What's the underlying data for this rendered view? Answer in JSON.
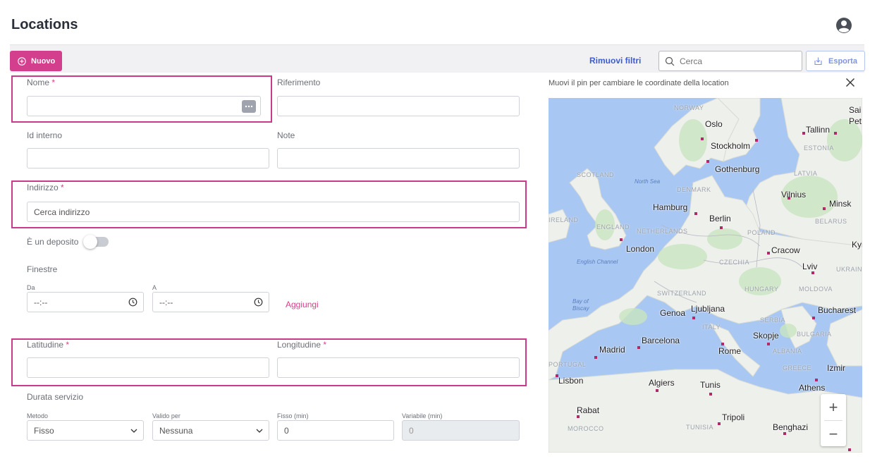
{
  "header": {
    "title": "Locations"
  },
  "toolbar": {
    "new_label": "Nuovo",
    "remove_filters_label": "Rimuovi filtri",
    "search_placeholder": "Cerca",
    "export_label": "Esporta"
  },
  "form": {
    "name_label": "Nome",
    "reference_label": "Riferimento",
    "internal_id_label": "Id interno",
    "notes_label": "Note",
    "address_label": "Indirizzo",
    "address_placeholder": "Cerca indirizzo",
    "depot_label": "È un deposito",
    "windows_label": "Finestre",
    "from_label": "Da",
    "to_label": "A",
    "time_placeholder": "--:--",
    "add_label": "Aggiungi",
    "latitude_label": "Latitudine",
    "longitude_label": "Longitudine",
    "service_duration_label": "Durata servizio",
    "method_label": "Metodo",
    "method_value": "Fisso",
    "valid_for_label": "Valido per",
    "valid_for_value": "Nessuna",
    "fixed_label": "Fisso (min)",
    "fixed_value": "0",
    "variable_label": "Variabile (min)",
    "variable_value": "0",
    "required_mark": "*"
  },
  "map": {
    "caption": "Muovi il pin per cambiare le coordinate della location",
    "cities": [
      "Oslo",
      "Tallinn",
      "Stockholm",
      "Gothenburg",
      "Vilnius",
      "Minsk",
      "Hamburg",
      "Berlin",
      "London",
      "Cracow",
      "Lviv",
      "Kyi",
      "Ljubljana",
      "Genoa",
      "Bucharest",
      "Barcelona",
      "Skopje",
      "Madrid",
      "Rome",
      "Izmir",
      "Lisbon",
      "Algiers",
      "Tunis",
      "Athens",
      "Rabat",
      "Tripoli",
      "Benghazi",
      "Sai",
      "Pet"
    ],
    "countries": [
      "NORWAY",
      "ESTONIA",
      "LATVIA",
      "DENMARK",
      "SCOTLAND",
      "IRELAND",
      "ENGLAND",
      "NETHERLANDS",
      "POLAND",
      "BELARUS",
      "CZECHIA",
      "UKRAIN",
      "SWITZERLAND",
      "HUNGARY",
      "MOLDOVA",
      "ITALY",
      "SERBIA",
      "BULGARIA",
      "ALBANIA",
      "GREECE",
      "PORTUGAL",
      "MOROCCO",
      "TUNISIA"
    ],
    "seas": [
      "North Sea",
      "English Channel",
      "Bay of",
      "Biscay"
    ],
    "zoom_in": "+",
    "zoom_out": "−"
  }
}
